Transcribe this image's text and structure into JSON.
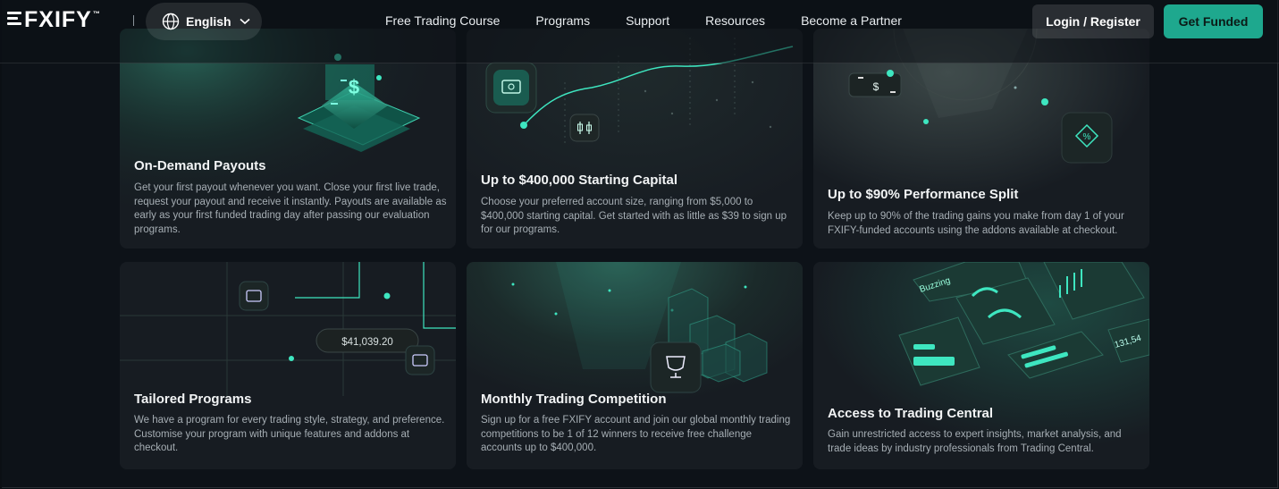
{
  "header": {
    "logo_text": "FXIFY",
    "logo_tm": "™",
    "language": "English",
    "nav": [
      "Free Trading Course",
      "Programs",
      "Support",
      "Resources",
      "Become a Partner"
    ],
    "login_label": "Login / Register",
    "cta_label": "Get Funded"
  },
  "cards": [
    {
      "title": "On-Demand Payouts",
      "text": "Get your first payout whenever you want. Close your first live trade, request your payout and receive it instantly. Payouts are available as early as your first funded trading day after passing our evaluation programs.",
      "icon": "dollar-icon"
    },
    {
      "title": "Up to $400,000 Starting Capital",
      "text": "Choose your preferred account size, ranging from $5,000 to $400,000 starting capital. Get started with as little as $39 to sign up for our programs.",
      "icon": "money-icon"
    },
    {
      "title": "Up to $90% Performance Split",
      "text": "Keep up to 90% of the trading gains you make from day 1 of your FXIFY-funded accounts using the addons available at checkout.",
      "icon": "percent-badge-icon"
    },
    {
      "title": "Tailored Programs",
      "text": "We have a program for every trading style, strategy, and preference. Customise your program with unique features and addons at checkout.",
      "icon": "wallet-icon",
      "amount": "$41,039.20"
    },
    {
      "title": "Monthly Trading Competition",
      "text": "Sign up for a free FXIFY account and join our global monthly trading competitions to be 1 of 12 winners to receive free challenge accounts up to $400,000.",
      "icon": "trophy-icon"
    },
    {
      "title": "Access to Trading Central",
      "text": "Gain unrestricted access to expert insights, market analysis, and trade ideas by industry professionals from Trading Central.",
      "icon": "dashboard-icon",
      "tags": [
        "Buzzing",
        "131,54"
      ]
    }
  ],
  "colors": {
    "accent": "#1ea88e",
    "background": "#0d1218",
    "card": "#171c22"
  }
}
